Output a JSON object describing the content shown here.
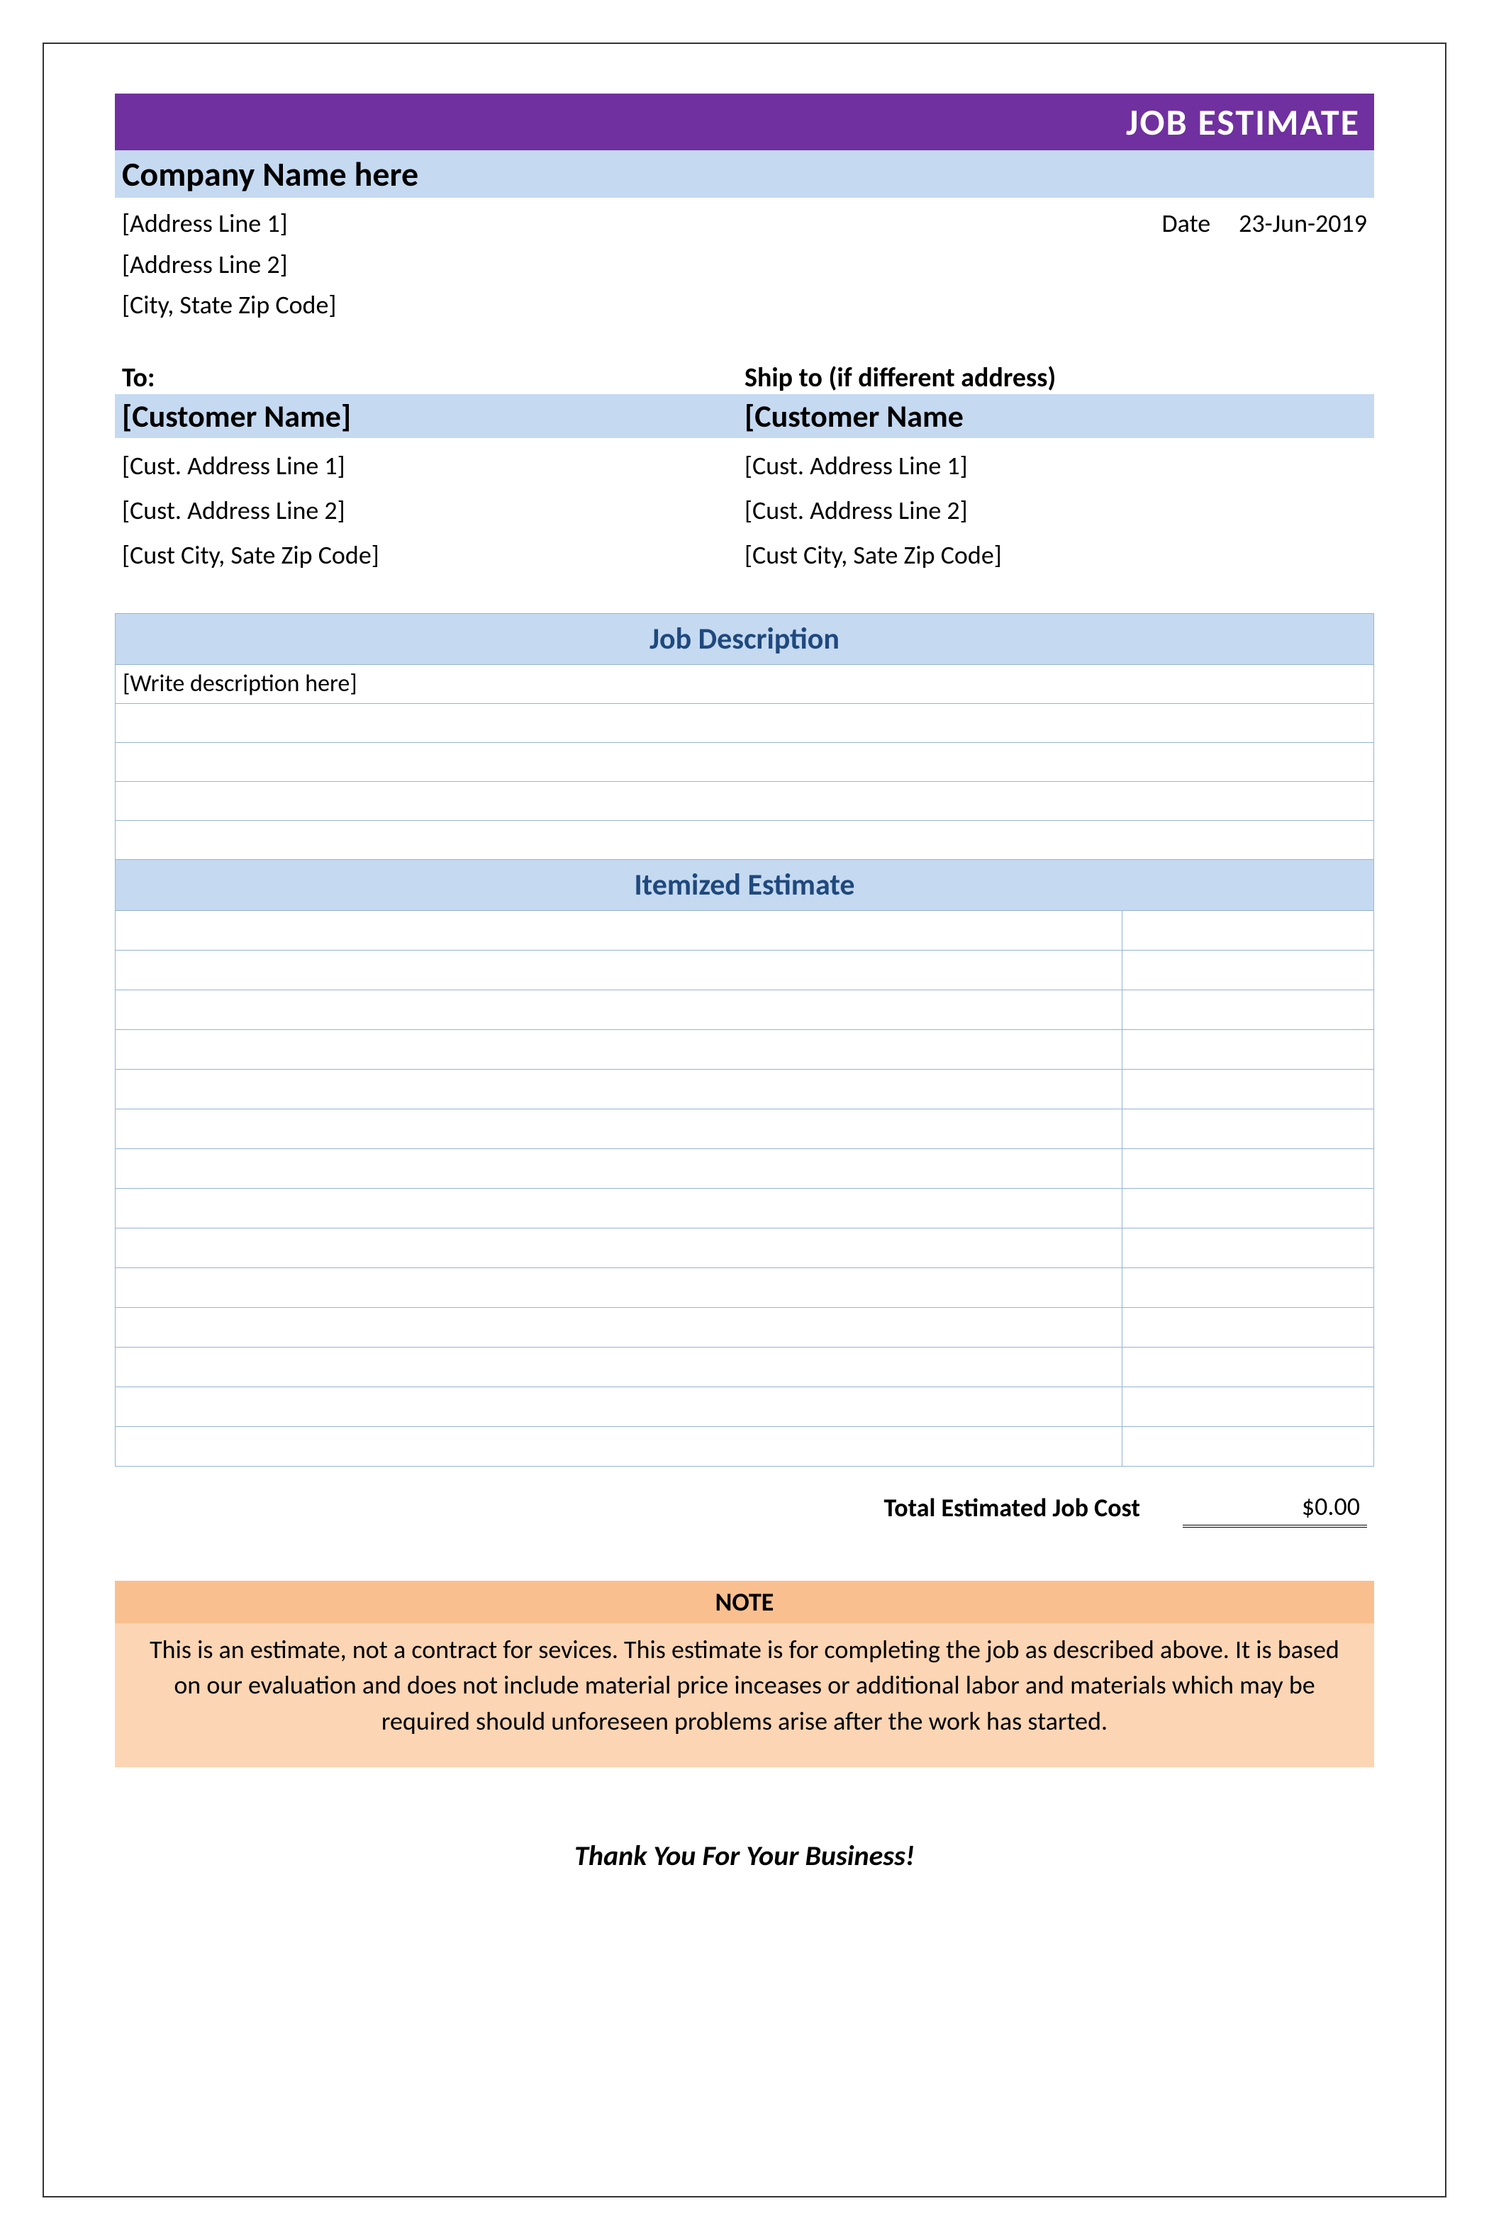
{
  "header": {
    "title": "JOB ESTIMATE",
    "company_name": "Company Name here",
    "address_line_1": "[Address Line 1]",
    "address_line_2": "[Address Line 2]",
    "city_state_zip": "[City, State Zip Code]",
    "date_label": "Date",
    "date_value": "23-Jun-2019"
  },
  "recipients": {
    "to_label": "To:",
    "ship_to_label": "Ship to (if different address)",
    "customer": {
      "name": "[Customer Name]",
      "addr1": "[Cust. Address Line 1]",
      "addr2": "[Cust. Address Line 2]",
      "city": "[Cust City, Sate Zip Code]"
    },
    "ship_to": {
      "name": "[Customer Name",
      "addr1": "[Cust. Address Line 1]",
      "addr2": "[Cust. Address Line 2]",
      "city": "[Cust City, Sate Zip Code]"
    }
  },
  "job_description": {
    "heading": "Job Description",
    "rows": [
      "[Write description here]",
      "",
      "",
      "",
      ""
    ]
  },
  "itemized": {
    "heading": "Itemized Estimate",
    "rows": [
      {
        "desc": "",
        "amt": ""
      },
      {
        "desc": "",
        "amt": ""
      },
      {
        "desc": "",
        "amt": ""
      },
      {
        "desc": "",
        "amt": ""
      },
      {
        "desc": "",
        "amt": ""
      },
      {
        "desc": "",
        "amt": ""
      },
      {
        "desc": "",
        "amt": ""
      },
      {
        "desc": "",
        "amt": ""
      },
      {
        "desc": "",
        "amt": ""
      },
      {
        "desc": "",
        "amt": ""
      },
      {
        "desc": "",
        "amt": ""
      },
      {
        "desc": "",
        "amt": ""
      },
      {
        "desc": "",
        "amt": ""
      },
      {
        "desc": "",
        "amt": ""
      }
    ]
  },
  "total": {
    "label": "Total Estimated Job Cost",
    "value": "$0.00"
  },
  "note": {
    "heading": "NOTE",
    "body": "This is an estimate, not a contract for sevices. This estimate is for completing the job as described above. It is based on our evaluation and does not include material price inceases or additional labor and materials which may be required should unforeseen problems arise after the work has started."
  },
  "footer": {
    "thank_you": "Thank You For Your Business!"
  }
}
